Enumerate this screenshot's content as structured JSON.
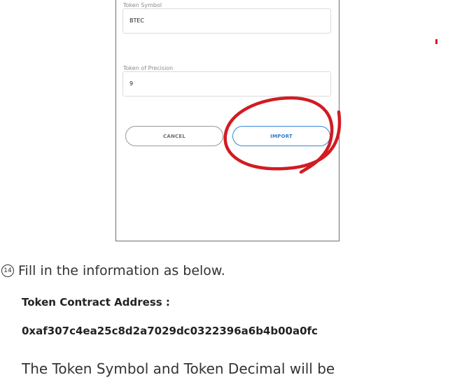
{
  "form": {
    "symbol_label": "Token Symbol",
    "symbol_value": "BTEC",
    "precision_label": "Token of Precision",
    "precision_value": "9",
    "cancel_label": "CANCEL",
    "import_label": "IMPORT"
  },
  "instructions": {
    "step_number": "14",
    "step_text": "Fill in the information as below.",
    "contract_label": "Token Contract Address :",
    "contract_address": "0xaf307c4ea25c8d2a7029dc0322396a6b4b00a0fc",
    "paragraph": "The Token Symbol and Token Decimal will be"
  },
  "colors": {
    "highlight_circle": "#d21b22",
    "import_accent": "#2f7bd1"
  }
}
